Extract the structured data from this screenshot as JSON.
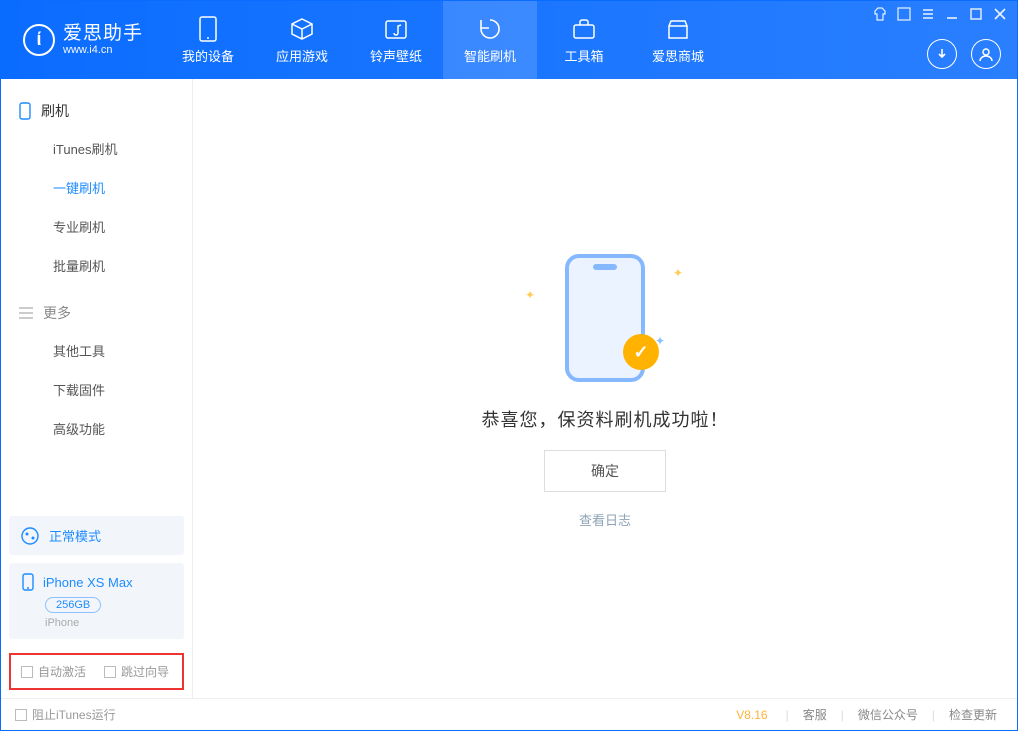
{
  "app": {
    "title": "爱思助手",
    "url": "www.i4.cn"
  },
  "header_tabs": [
    {
      "label": "我的设备"
    },
    {
      "label": "应用游戏"
    },
    {
      "label": "铃声壁纸"
    },
    {
      "label": "智能刷机"
    },
    {
      "label": "工具箱"
    },
    {
      "label": "爱思商城"
    }
  ],
  "sidebar": {
    "flash_header": "刷机",
    "flash_items": [
      "iTunes刷机",
      "一键刷机",
      "专业刷机",
      "批量刷机"
    ],
    "more_header": "更多",
    "more_items": [
      "其他工具",
      "下载固件",
      "高级功能"
    ],
    "mode_label": "正常模式",
    "device": {
      "name": "iPhone XS Max",
      "capacity": "256GB",
      "type": "iPhone"
    },
    "checkboxes": {
      "auto_activate": "自动激活",
      "skip_guide": "跳过向导"
    }
  },
  "main": {
    "success_msg": "恭喜您，保资料刷机成功啦！",
    "confirm_label": "确定",
    "view_log": "查看日志"
  },
  "footer": {
    "stop_itunes": "阻止iTunes运行",
    "version": "V8.16",
    "links": [
      "客服",
      "微信公众号",
      "检查更新"
    ]
  }
}
